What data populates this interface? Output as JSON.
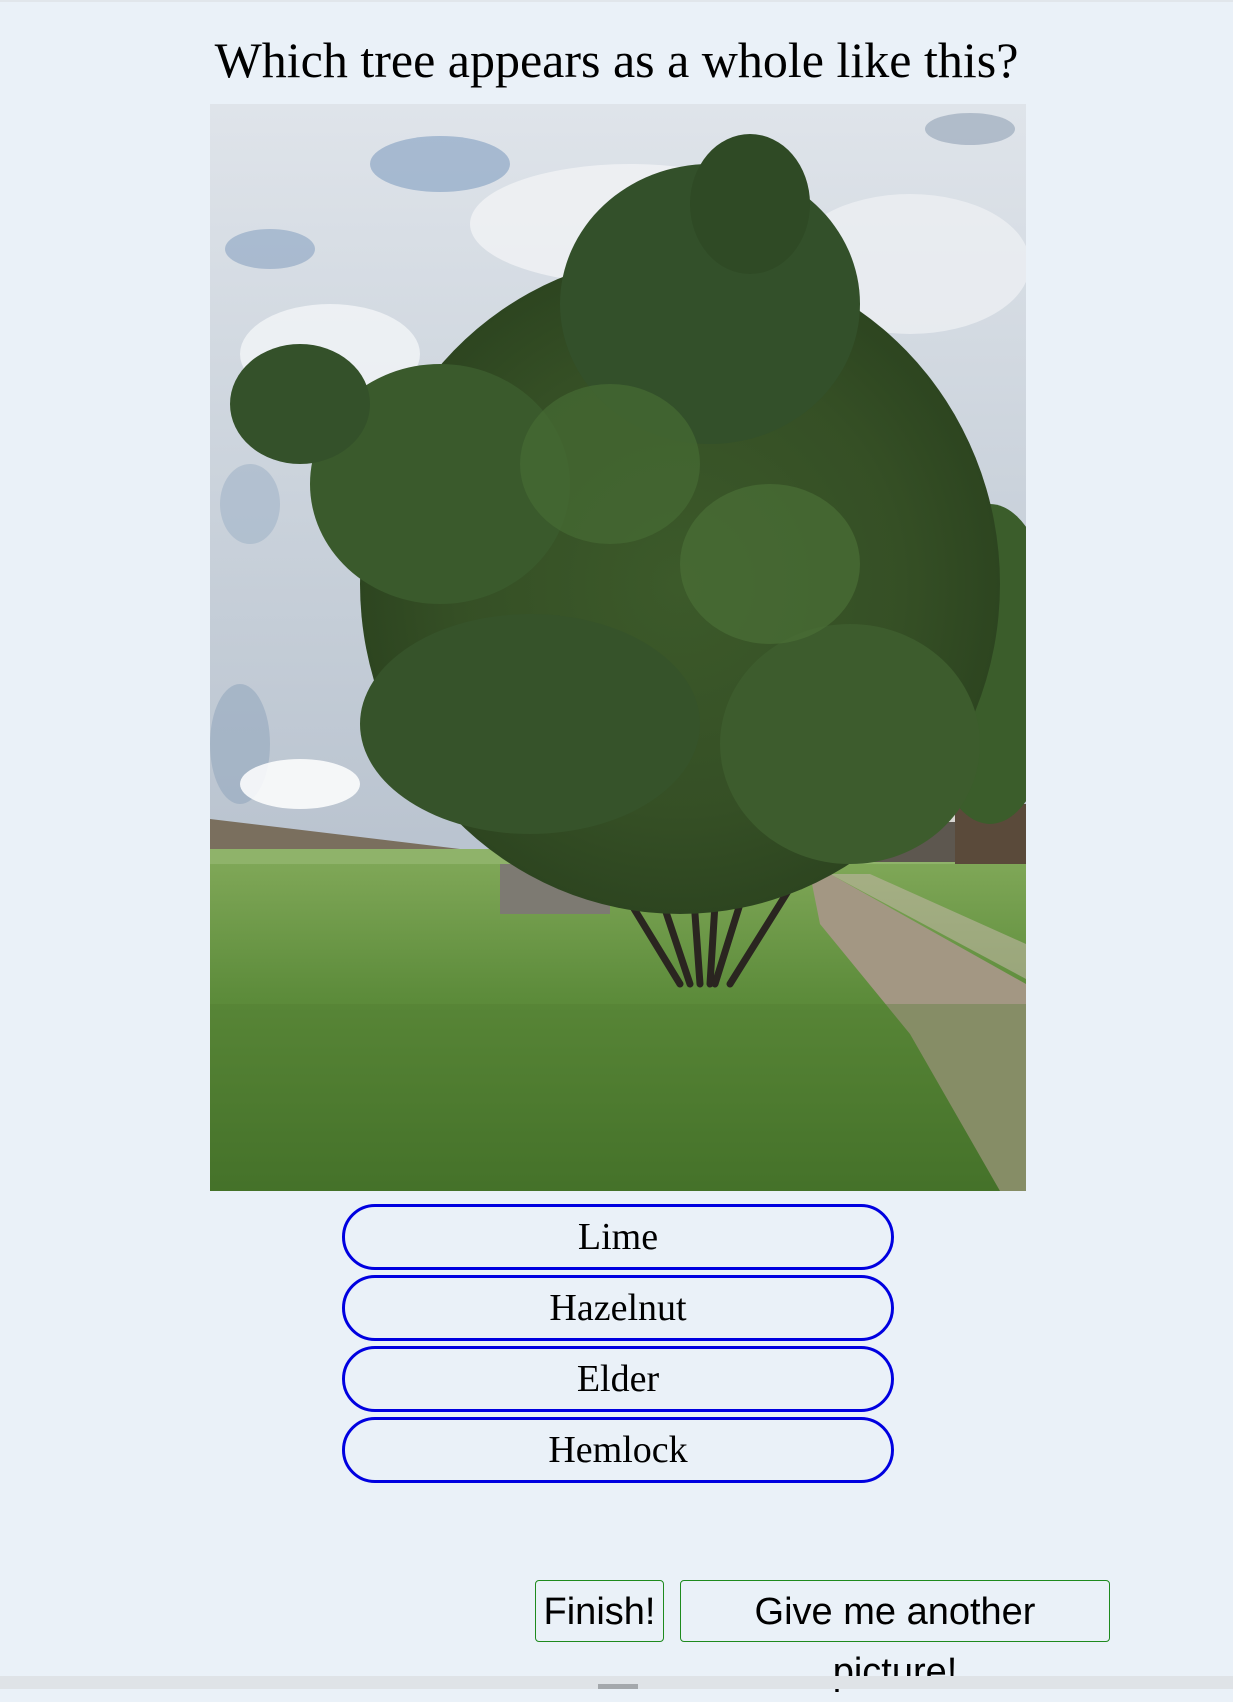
{
  "question": {
    "text": "Which tree appears as a whole like this?"
  },
  "photo": {
    "subject": "tree-photo"
  },
  "answers": [
    {
      "label": "Lime"
    },
    {
      "label": "Hazelnut"
    },
    {
      "label": "Elder"
    },
    {
      "label": "Hemlock"
    }
  ],
  "actions": {
    "finish_label": "Finish!",
    "another_label": "Give me another picture!"
  },
  "colors": {
    "background": "#eaf1f8",
    "answer_border": "#0000e0",
    "action_border": "#1e8a1e"
  }
}
